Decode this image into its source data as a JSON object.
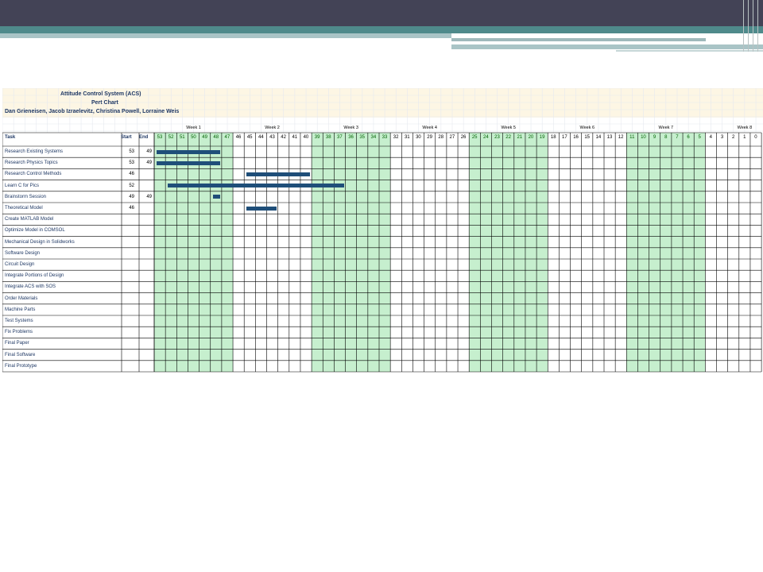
{
  "title": "Attitude Control System (ACS)",
  "subtitle": "Pert Chart",
  "authors": "Dan Grieneisen, Jacob Izraelevitz, Christina Powell, Lorraine Weis",
  "headers": {
    "task": "Task",
    "start": "Start",
    "end": "End"
  },
  "weeks": [
    "Week 1",
    "Week 2",
    "Week 3",
    "Week 4",
    "Week 5",
    "Week 6",
    "Week 7",
    "Week 8"
  ],
  "day_numbers": [
    "53",
    "52",
    "51",
    "50",
    "49",
    "48",
    "47",
    "46",
    "45",
    "44",
    "43",
    "42",
    "41",
    "40",
    "39",
    "38",
    "37",
    "36",
    "35",
    "34",
    "33",
    "32",
    "31",
    "30",
    "29",
    "28",
    "27",
    "26",
    "25",
    "24",
    "23",
    "22",
    "21",
    "20",
    "19",
    "18",
    "17",
    "16",
    "15",
    "14",
    "13",
    "12",
    "11",
    "10",
    "9",
    "8",
    "7",
    "6",
    "5",
    "4",
    "3",
    "2",
    "1",
    "0"
  ],
  "tasks": [
    {
      "name": "Research Existing Systems",
      "start": "53",
      "end": "49"
    },
    {
      "name": "Research Physics Topics",
      "start": "53",
      "end": "49"
    },
    {
      "name": "Research Control Methods",
      "start": "46",
      "end": ""
    },
    {
      "name": "Learn C for Pics",
      "start": "52",
      "end": ""
    },
    {
      "name": "Brainstorm Session",
      "start": "49",
      "end": "49"
    },
    {
      "name": "Theoretical Model",
      "start": "46",
      "end": ""
    },
    {
      "name": "Create MATLAB Model",
      "start": "",
      "end": ""
    },
    {
      "name": "Optimize Model in COMSOL",
      "start": "",
      "end": ""
    },
    {
      "name": "Mechanical Design in Solidworks",
      "start": "",
      "end": ""
    },
    {
      "name": "Software Design",
      "start": "",
      "end": ""
    },
    {
      "name": "Circuit Design",
      "start": "",
      "end": ""
    },
    {
      "name": "Integrate Portions of Design",
      "start": "",
      "end": ""
    },
    {
      "name": "Integrate ACS with SOS",
      "start": "",
      "end": ""
    },
    {
      "name": "Order Materials",
      "start": "",
      "end": ""
    },
    {
      "name": "Machine Parts",
      "start": "",
      "end": ""
    },
    {
      "name": "Test Systems",
      "start": "",
      "end": ""
    },
    {
      "name": "Fix Problems",
      "start": "",
      "end": ""
    },
    {
      "name": "Final Paper",
      "start": "",
      "end": ""
    },
    {
      "name": "Final Software",
      "start": "",
      "end": ""
    },
    {
      "name": "Final Prototype",
      "start": "",
      "end": ""
    }
  ],
  "bars": [
    {
      "row": 0,
      "from": "53",
      "to": "48"
    },
    {
      "row": 1,
      "from": "53",
      "to": "48"
    },
    {
      "row": 2,
      "from": "45",
      "to": "40"
    },
    {
      "row": 3,
      "from": "52",
      "to": "37"
    },
    {
      "row": 4,
      "from": "48",
      "to": "48"
    },
    {
      "row": 5,
      "from": "45",
      "to": "43"
    }
  ],
  "colors": {
    "week_fill": "#c6efce",
    "bar": "#1f4e79",
    "title_text": "#1f3864",
    "top_bar": "#434356",
    "teal_stripe": "#4f8a8b"
  }
}
